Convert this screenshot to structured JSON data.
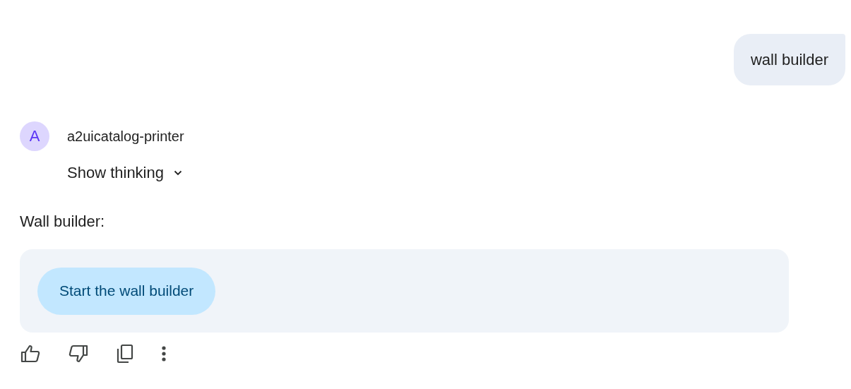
{
  "user_message": {
    "text": "wall builder"
  },
  "agent": {
    "avatar_letter": "A",
    "name": "a2uicatalog-printer"
  },
  "thinking": {
    "label": "Show thinking",
    "expanded": false
  },
  "response": {
    "text": "Wall builder:",
    "card": {
      "button": {
        "label": "Start the wall builder"
      }
    }
  }
}
